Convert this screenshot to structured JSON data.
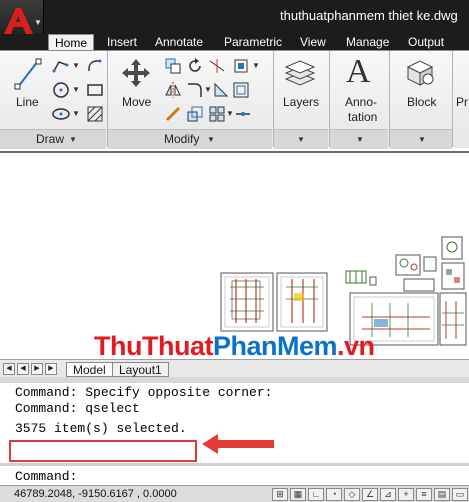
{
  "window": {
    "title": "thuthuatphanmem thiet ke.dwg"
  },
  "tabs": [
    {
      "label": "Home",
      "active": true
    },
    {
      "label": "Insert"
    },
    {
      "label": "Annotate"
    },
    {
      "label": "Parametric"
    },
    {
      "label": "View"
    },
    {
      "label": "Manage"
    },
    {
      "label": "Output"
    }
  ],
  "ribbon": {
    "draw": {
      "title": "Draw",
      "line_label": "Line"
    },
    "modify": {
      "title": "Modify",
      "move_label": "Move"
    },
    "layers": {
      "label": "Layers"
    },
    "annotation": {
      "label_1": "Anno-",
      "label_2": "tation",
      "glyph": "A"
    },
    "block": {
      "label": "Block"
    },
    "overflow": {
      "label": "Pr"
    }
  },
  "watermark": {
    "part1": "ThuThuat",
    "part2": "PhanMem",
    "part3": ".vn"
  },
  "layout_tabs": [
    {
      "label": "Model"
    },
    {
      "label": "Layout1"
    }
  ],
  "command": {
    "line1": "Command: Specify opposite corner:",
    "line2": "Command: qselect",
    "line3": "3575 item(s) selected.",
    "prompt": "Command:"
  },
  "status": {
    "coords": "46789.2048, -9150.6167 , 0.0000"
  },
  "colors": {
    "highlight": "#e53935",
    "watermark_red": "#e21b23",
    "watermark_blue": "#0a73c9"
  }
}
